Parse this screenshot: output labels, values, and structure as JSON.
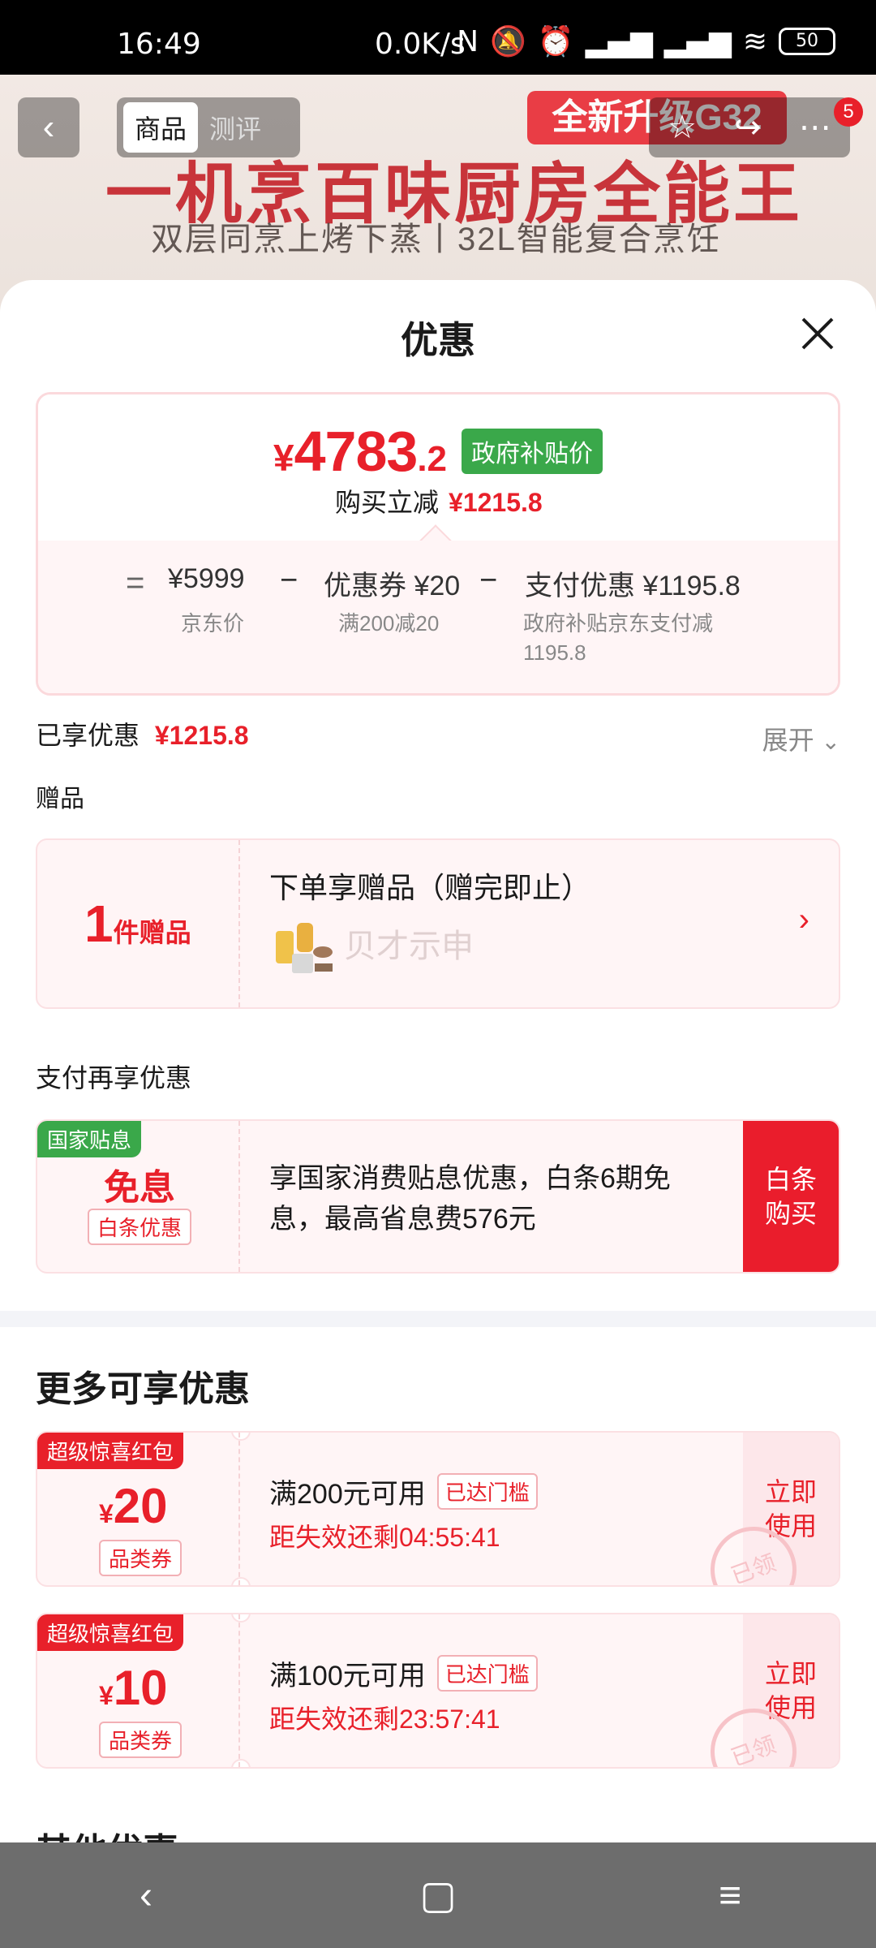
{
  "status_bar": {
    "time": "16:49",
    "network_speed": "0.0K/s",
    "battery": "50"
  },
  "background": {
    "promo_badge": "全新升级G32",
    "headline": "一机烹百味厨房全能王",
    "subline": "双层同烹上烤下蒸丨32L智能复合烹饪"
  },
  "header": {
    "tabs": [
      {
        "label": "商品"
      },
      {
        "label": "测评"
      }
    ],
    "cart_count": "5"
  },
  "sheet": {
    "title": "优惠",
    "price": {
      "currency": "¥",
      "integer": "4783",
      "decimal": ".2",
      "tag": "政府补贴价",
      "reduce_label": "购买立减",
      "reduce_value": "¥1215.8"
    },
    "formula": {
      "eq": "=",
      "jd_price": "¥5999",
      "jd_price_label": "京东价",
      "minus1": "−",
      "coupon": "优惠券 ¥20",
      "coupon_label": "满200减20",
      "minus2": "−",
      "pay": "支付优惠 ¥1195.8",
      "pay_label_1": "政府补贴京东支付减",
      "pay_label_2": "1195.8"
    },
    "enjoyed": {
      "label": "已享优惠",
      "value": "¥1215.8",
      "expand": "展开"
    },
    "gift": {
      "section": "赠品",
      "count": "1",
      "unit": "件赠品",
      "title": "下单享赠品（赠完即止）",
      "item_name": "贝才示申",
      "chevron": "›"
    },
    "pay_again": {
      "section": "支付再享优惠",
      "tag": "国家贴息",
      "main": "免息",
      "sub": "白条优惠",
      "desc": "享国家消费贴息优惠，白条6期免息，最高省息费576元",
      "btn_line1": "白条",
      "btn_line2": "购买"
    },
    "more": {
      "title": "更多可享优惠",
      "coupons": [
        {
          "tag": "超级惊喜红包",
          "symbol": "¥",
          "amount": "20",
          "type": "品类券",
          "cond": "满200元可用",
          "reach": "已达门槛",
          "countdown": "距失效还剩04:55:41",
          "use1": "立即",
          "use2": "使用",
          "stamp": "已领"
        },
        {
          "tag": "超级惊喜红包",
          "symbol": "¥",
          "amount": "10",
          "type": "品类券",
          "cond": "满100元可用",
          "reach": "已达门槛",
          "countdown": "距失效还剩23:57:41",
          "use1": "立即",
          "use2": "使用",
          "stamp": "已领"
        }
      ]
    },
    "other_title": "其他优惠"
  },
  "colors": {
    "accent": "#e8202a",
    "green": "#3aa84a",
    "pink_bg": "#fff5f6"
  }
}
